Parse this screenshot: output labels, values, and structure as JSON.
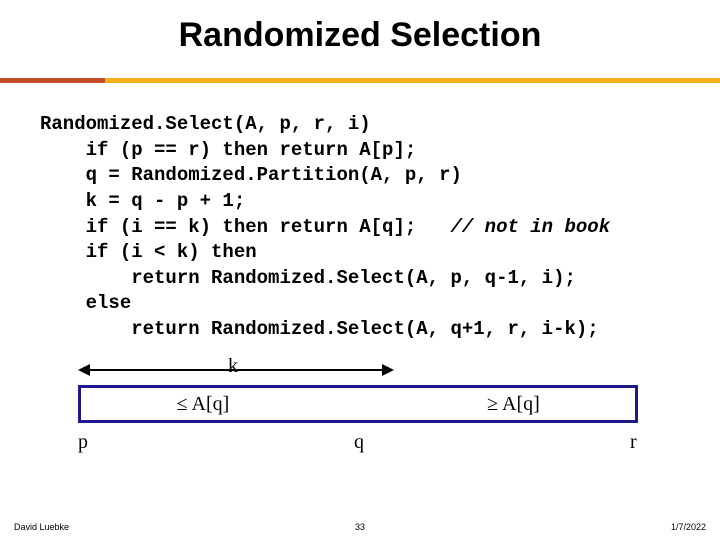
{
  "title": "Randomized Selection",
  "code": {
    "l1": "Randomized.Select(A, p, r, i)",
    "l2": "    if (p == r) then return A[p];",
    "l3": "    q = Randomized.Partition(A, p, r)",
    "l4": "    k = q - p + 1;",
    "l5a": "    if (i == k) then return A[q];   ",
    "l5b": "// not in book",
    "l6": "    if (i < k) then",
    "l7": "        return Randomized.Select(A, p, q-1, i);",
    "l8": "    else",
    "l9": "        return Randomized.Select(A, q+1, r, i-k);"
  },
  "diagram": {
    "k": "k",
    "left": "≤ A[q]",
    "right": "≥ A[q]",
    "p": "p",
    "q": "q",
    "r": "r"
  },
  "footer": {
    "author": "David Luebke",
    "page": "33",
    "date": "1/7/2022"
  }
}
